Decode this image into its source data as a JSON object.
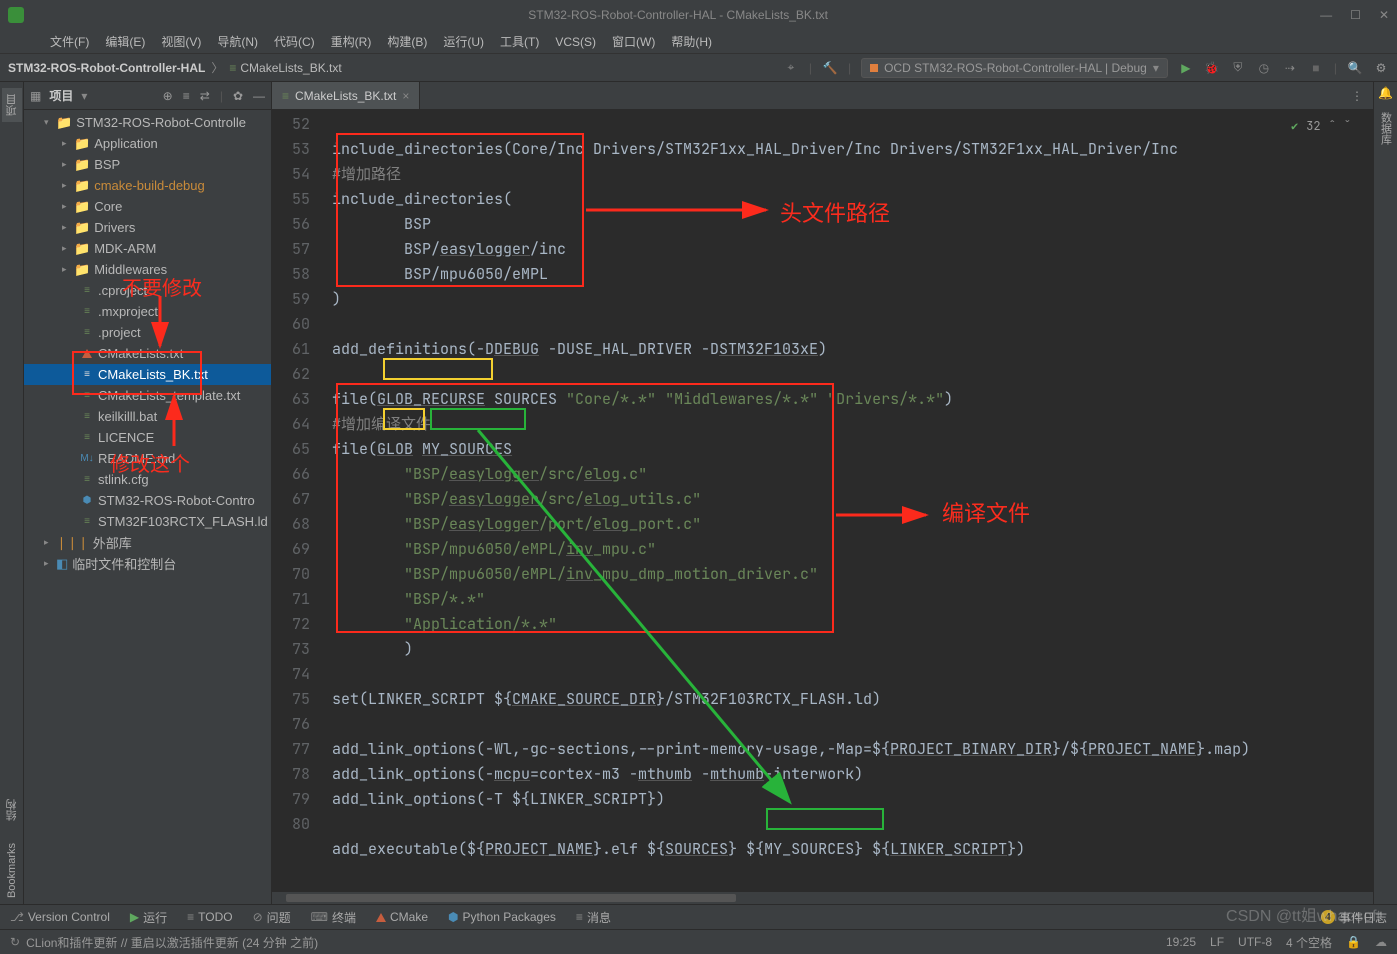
{
  "window": {
    "title": "STM32-ROS-Robot-Controller-HAL - CMakeLists_BK.txt"
  },
  "menu": {
    "file": "文件(F)",
    "edit": "编辑(E)",
    "view": "视图(V)",
    "nav": "导航(N)",
    "code": "代码(C)",
    "refactor": "重构(R)",
    "build": "构建(B)",
    "run": "运行(U)",
    "tools": "工具(T)",
    "vcs": "VCS(S)",
    "window": "窗口(W)",
    "help": "帮助(H)"
  },
  "breadcrumb": {
    "project": "STM32-ROS-Robot-Controller-HAL",
    "file": "CMakeLists_BK.txt"
  },
  "runConfig": {
    "label": "OCD STM32-ROS-Robot-Controller-HAL | Debug"
  },
  "sidebar": {
    "header": "项目",
    "root": "STM32-ROS-Robot-Controlle",
    "folders": {
      "app": "Application",
      "bsp": "BSP",
      "cmake": "cmake-build-debug",
      "core": "Core",
      "drivers": "Drivers",
      "mdk": "MDK-ARM",
      "mw": "Middlewares"
    },
    "files": {
      "cproject": ".cproject",
      "mxproject": ".mxproject",
      "project": ".project",
      "cmakelists": "CMakeLists.txt",
      "cmakelistsbk": "CMakeLists_BK.txt",
      "template": "CMakeLists_template.txt",
      "keil": "keilkilll.bat",
      "licence": "LICENCE",
      "readme": "README.md",
      "stlink": "stlink.cfg",
      "ioc": "STM32-ROS-Robot-Contro",
      "flash": "STM32F103RCTX_FLASH.ld"
    },
    "ext": "外部库",
    "scratch": "临时文件和控制台"
  },
  "leftTabs": {
    "project": "项目",
    "structure": "结构",
    "bookmarks": "Bookmarks"
  },
  "rightTabs": {
    "notif": "通知",
    "db": "数据库"
  },
  "tab": {
    "name": "CMakeLists_BK.txt"
  },
  "codeTop": {
    "count": "32"
  },
  "code": {
    "l52a": "include_directories(Core/Inc Drivers/STM32F1xx_HAL_Driver/Inc Drivers/STM32F1xx_HAL_Driver/Inc",
    "l53": "#增加路径",
    "l54": "include_directories(",
    "l55": "        BSP",
    "l56": "        BSP/easylogger/inc",
    "l57": "        BSP/mpu6050/eMPL",
    "l58": ")",
    "l60a": "add_definitions(-D",
    "l60b": "DEBUG",
    "l60c": " -DUSE_HAL_DRIVER -D",
    "l60d": "STM32F103xE",
    "l60e": ")",
    "l62a": "file(",
    "l62b": "GLOB_RECURSE",
    "l62c": " SOURCES ",
    "l62s1": "\"Core/*.*\"",
    "l62s2": " \"Middlewares/*.*\" ",
    "l62s3": "\"Drivers/*.*\"",
    "l62d": ")",
    "l63": "#增加编译文件",
    "l64a": "file(",
    "l64b": "GLOB",
    "l64c": " ",
    "l64d": "MY_SOURCES",
    "l65": "        \"BSP/easylogger/src/elog.c\"",
    "l66": "        \"BSP/easylogger/src/elog_utils.c\"",
    "l67": "        \"BSP/easylogger/port/elog_port.c\"",
    "l68": "        \"BSP/mpu6050/eMPL/inv_mpu.c\"",
    "l69": "        \"BSP/mpu6050/eMPL/inv_mpu_dmp_motion_driver.c\"",
    "l70": "        \"BSP/*.*\"",
    "l71": "        \"Application/*.*\"",
    "l72": "        )",
    "l74a": "set(LINKER_SCRIPT ${",
    "l74b": "CMAKE_SOURCE_DIR",
    "l74c": "}/STM32F103RCTX_FLASH.ld)",
    "l76a": "add_link_options(-Wl,-gc-sections,--print-memory-usage,-Map=${",
    "l76b": "PROJECT_BINARY_DIR",
    "l76c": "}/${",
    "l76d": "PROJECT_NAME",
    "l76e": "}.map)",
    "l77a": "add_link_options(-",
    "l77b": "mcpu",
    "l77c": "=cortex-m3 -",
    "l77d": "mthumb",
    "l77e": " -",
    "l77f": "mthumb",
    "l77g": "-interwork)",
    "l78": "add_link_options(-T ${LINKER_SCRIPT})",
    "l80a": "add_executable(${",
    "l80b": "PROJECT_NAME",
    "l80c": "}.elf ${",
    "l80d": "SOURCES",
    "l80e": "} ",
    "l80f": "${MY_SOURCES}",
    "l80g": " ${",
    "l80h": "LINKER_SCRIPT",
    "l80i": "})"
  },
  "lines": [
    "52",
    "53",
    "54",
    "55",
    "56",
    "57",
    "58",
    "59",
    "60",
    "61",
    "62",
    "63",
    "64",
    "65",
    "66",
    "67",
    "68",
    "69",
    "70",
    "71",
    "72",
    "73",
    "74",
    "75",
    "76",
    "77",
    "78",
    "79",
    "80"
  ],
  "bottomTools": {
    "vc": "Version Control",
    "run": "运行",
    "todo": "TODO",
    "problems": "问题",
    "terminal": "终端",
    "cmake": "CMake",
    "python": "Python Packages",
    "messages": "消息",
    "events": "事件日志"
  },
  "status": {
    "left": "CLion和插件更新 // 重启以激活插件更新 (24 分钟 之前)",
    "pos": "19:25",
    "lf": "LF",
    "enc": "UTF-8",
    "spaces": "4 个空格"
  },
  "annotations": {
    "dontModify": "不要修改",
    "modifyThis": "修改这个",
    "headerPath": "头文件路径",
    "compileFiles": "编译文件"
  },
  "watermark": "CSDN @tt姐whaosoft"
}
